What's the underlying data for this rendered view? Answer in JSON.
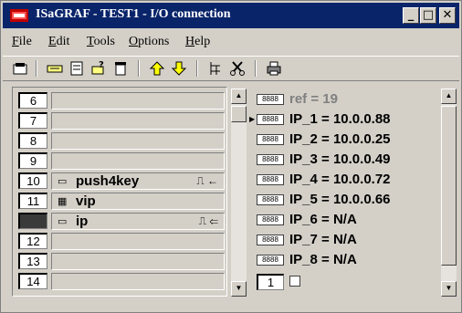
{
  "window": {
    "title": "ISaGRAF - TEST1 - I/O connection",
    "minimize_label": "_",
    "maximize_label": "□",
    "close_label": "✕"
  },
  "menu": [
    "File",
    "Edit",
    "Tools",
    "Options",
    "Help"
  ],
  "toolbar_icons": [
    "open-icon",
    "connect-board-icon",
    "set-board-icon",
    "board-params-icon",
    "delete-icon",
    "move-up-icon",
    "move-down-icon",
    "tree-icon",
    "cut-icon",
    "print-icon"
  ],
  "channels": [
    {
      "num": "6",
      "name": "",
      "mark": ""
    },
    {
      "num": "7",
      "name": "",
      "mark": ""
    },
    {
      "num": "8",
      "name": "",
      "mark": ""
    },
    {
      "num": "9",
      "name": "",
      "mark": ""
    },
    {
      "num": "10",
      "name": "push4key",
      "mark": "⎍ ←"
    },
    {
      "num": "11",
      "name": "vip",
      "mark": ""
    },
    {
      "num": "",
      "name": "ip",
      "mark": "⎍ ⇐"
    },
    {
      "num": "12",
      "name": "",
      "mark": ""
    },
    {
      "num": "13",
      "name": "",
      "mark": ""
    },
    {
      "num": "14",
      "name": "",
      "mark": ""
    }
  ],
  "variables": [
    {
      "text": "ref = 19"
    },
    {
      "text": "IP_1 = 10.0.0.88"
    },
    {
      "text": "IP_2 = 10.0.0.25"
    },
    {
      "text": "IP_3 = 10.0.0.49"
    },
    {
      "text": "IP_4 = 10.0.0.72"
    },
    {
      "text": "IP_5 = 10.0.0.66"
    },
    {
      "text": "IP_6 = N/A"
    },
    {
      "text": "IP_7 = N/A"
    },
    {
      "text": "IP_8 = N/A"
    }
  ],
  "var_icon_label": "8888",
  "bottom_index": "1"
}
